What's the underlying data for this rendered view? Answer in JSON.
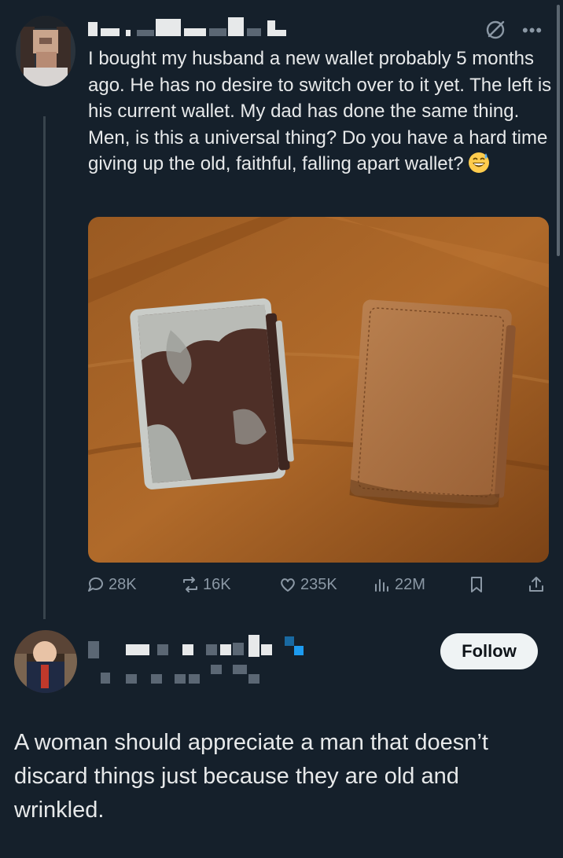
{
  "post": {
    "text": "I bought my husband a new wallet probably 5 months ago. He has no desire to switch over to it yet. The left is his current wallet. My dad has done the same thing. Men, is this a universal thing? Do you have a hard time giving up the old, faithful, falling apart wallet?",
    "emoji": "grinning-face-with-sweat",
    "media_alt_icon": "photo-two-wallets",
    "stats": {
      "replies": "28K",
      "reposts": "16K",
      "likes": "235K",
      "views": "22M"
    }
  },
  "reply": {
    "follow_label": "Follow",
    "text": "A woman should appreciate a man that doesn’t discard things just because they are old and wrinkled."
  },
  "colors": {
    "background": "#15202b",
    "text": "#e7e9ea",
    "muted": "#8b98a5",
    "verified": "#1d9bf0"
  }
}
